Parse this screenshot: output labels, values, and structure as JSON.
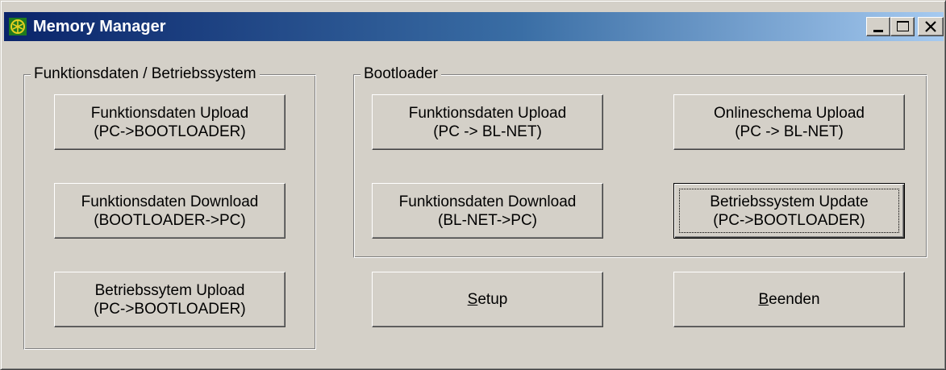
{
  "window": {
    "title": "Memory Manager",
    "icon": "memory-manager-app-icon",
    "controls": [
      "minimize-icon",
      "maximize-icon",
      "close-icon"
    ]
  },
  "group_left": {
    "legend": "Funktionsdaten / Betriebssystem",
    "buttons": [
      {
        "line1": "Funktionsdaten Upload",
        "line2": "(PC->BOOTLOADER)"
      },
      {
        "line1": "Funktionsdaten Download",
        "line2": "(BOOTLOADER->PC)"
      },
      {
        "line1": "Betriebssytem Upload",
        "line2": "(PC->BOOTLOADER)"
      }
    ]
  },
  "group_bootloader": {
    "legend": "Bootloader",
    "buttons": [
      {
        "line1": "Funktionsdaten Upload",
        "line2": "(PC -> BL-NET)"
      },
      {
        "line1": "Onlineschema Upload",
        "line2": "(PC -> BL-NET)"
      },
      {
        "line1": "Funktionsdaten Download",
        "line2": "(BL-NET->PC)"
      },
      {
        "line1": "Betriebssystem Update",
        "line2": "(PC->BOOTLOADER)"
      }
    ]
  },
  "actions": {
    "setup": {
      "mnemonic": "S",
      "rest": "etup"
    },
    "beenden": {
      "mnemonic": "B",
      "rest": "eenden"
    }
  },
  "colors": {
    "face": "#d4d0c8",
    "title_start": "#0a246a",
    "title_end": "#a6caf0",
    "title_text": "#ffffff",
    "icon_bg": "#1f7a1f",
    "icon_fg": "#e8d020"
  }
}
